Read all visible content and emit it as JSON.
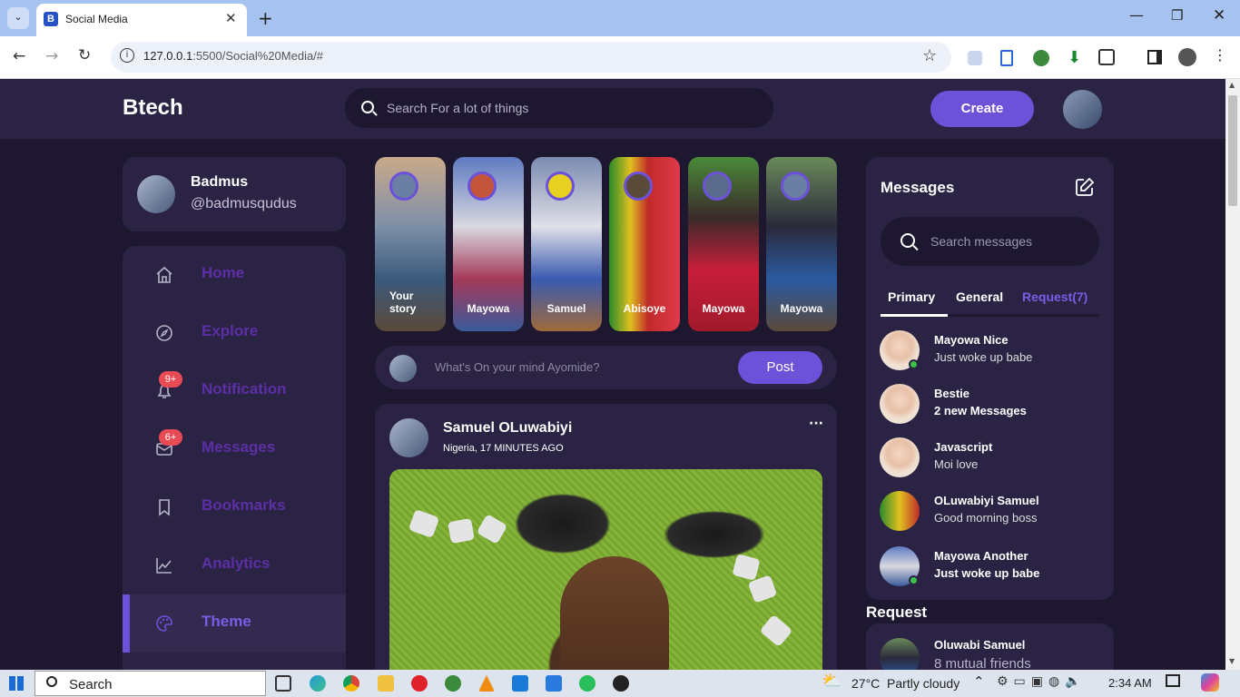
{
  "browser": {
    "tab_title": "Social Media",
    "url_host": "127.0.0.1",
    "url_rest": ":5500/Social%20Media/#"
  },
  "nav": {
    "logo": "Btech",
    "search_placeholder": "Search For a lot of things",
    "create_label": "Create"
  },
  "profile": {
    "name": "Badmus",
    "handle": "@badmusqudus"
  },
  "sidebar": {
    "items": [
      {
        "label": "Home",
        "icon": "home-icon"
      },
      {
        "label": "Explore",
        "icon": "compass-icon"
      },
      {
        "label": "Notification",
        "icon": "bell-icon",
        "badge": "9+"
      },
      {
        "label": "Messages",
        "icon": "envelope-icon",
        "badge": "6+"
      },
      {
        "label": "Bookmarks",
        "icon": "bookmark-icon"
      },
      {
        "label": "Analytics",
        "icon": "chart-icon"
      },
      {
        "label": "Theme",
        "icon": "palette-icon",
        "active": true
      }
    ]
  },
  "stories": [
    {
      "name": "Your story",
      "line1": "Your",
      "line2": "story"
    },
    {
      "name": "Mayowa"
    },
    {
      "name": "Samuel"
    },
    {
      "name": "Abisoye"
    },
    {
      "name": "Mayowa"
    },
    {
      "name": "Mayowa"
    }
  ],
  "composer": {
    "placeholder": "What's On your mind Ayomide?",
    "post_label": "Post"
  },
  "post": {
    "author": "Samuel OLuwabiyi",
    "meta": "Nigeria, 17 MINUTES AGO",
    "menu": "···"
  },
  "messages": {
    "title": "Messages",
    "search_placeholder": "Search messages",
    "tabs": [
      "Primary",
      "General",
      "Request(7)"
    ],
    "items": [
      {
        "name": "Mayowa Nice",
        "text": "Just woke up babe",
        "online": true
      },
      {
        "name": "Bestie",
        "text": "2 new Messages",
        "online": false
      },
      {
        "name": "Javascript",
        "text": "Moi love",
        "online": false
      },
      {
        "name": "OLuwabiyi Samuel",
        "text": "Good morning boss",
        "online": false
      },
      {
        "name": "Mayowa Another",
        "text": "Just woke up babe",
        "online": true
      }
    ]
  },
  "request": {
    "title": "Request",
    "name": "Oluwabi Samuel",
    "text": "8 mutual friends"
  },
  "taskbar": {
    "search_label": "Search",
    "weather": "27°C  Partly cloudy",
    "time": "2:34 AM"
  },
  "colors": {
    "accent": "#6c52d9",
    "panel": "#2b2344",
    "background": "#1d1830",
    "badge": "#e94b55"
  }
}
